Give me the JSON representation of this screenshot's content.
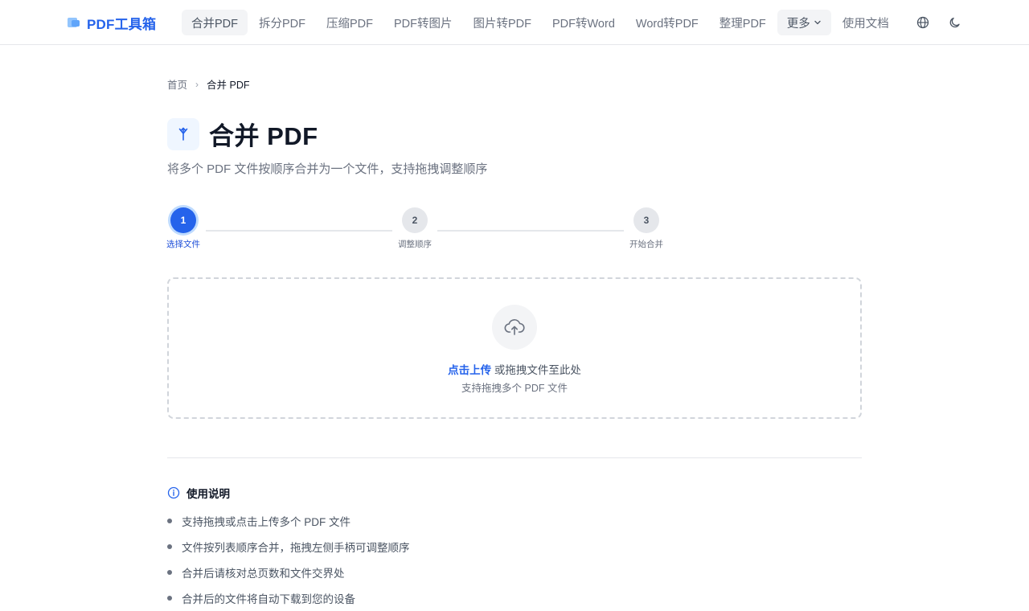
{
  "brand": {
    "name": "PDF工具箱"
  },
  "nav": {
    "items": [
      {
        "label": "合并PDF",
        "active": true
      },
      {
        "label": "拆分PDF"
      },
      {
        "label": "压缩PDF"
      },
      {
        "label": "PDF转图片"
      },
      {
        "label": "图片转PDF"
      },
      {
        "label": "PDF转Word"
      },
      {
        "label": "Word转PDF"
      },
      {
        "label": "整理PDF"
      }
    ],
    "more_label": "更多",
    "docs_label": "使用文档"
  },
  "breadcrumb": {
    "home": "首页",
    "separator": "›",
    "current": "合并 PDF"
  },
  "page": {
    "title": "合并 PDF",
    "subtitle": "将多个 PDF 文件按顺序合并为一个文件，支持拖拽调整顺序"
  },
  "steps": [
    {
      "number": "1",
      "label": "选择文件",
      "active": true
    },
    {
      "number": "2",
      "label": "调整顺序",
      "active": false
    },
    {
      "number": "3",
      "label": "开始合并",
      "active": false
    }
  ],
  "dropzone": {
    "link_text": "点击上传",
    "text": "或拖拽文件至此处",
    "hint": "支持拖拽多个 PDF 文件",
    "icon": "upload-cloud-icon"
  },
  "instructions": {
    "title": "使用说明",
    "items": [
      "支持拖拽或点击上传多个 PDF 文件",
      "文件按列表顺序合并，拖拽左侧手柄可调整顺序",
      "合并后请核对总页数和文件交界处",
      "合并后的文件将自动下载到您的设备"
    ]
  },
  "colors": {
    "accent": "#2563eb",
    "text": "#111827",
    "muted": "#6b7280",
    "border": "#e5e7eb"
  }
}
